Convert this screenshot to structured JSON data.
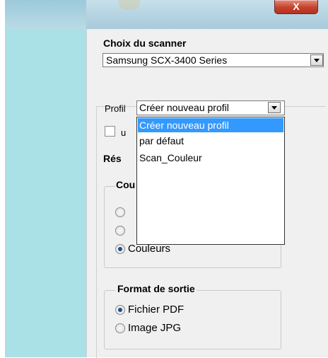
{
  "window": {
    "close_symbol": "X"
  },
  "scanner": {
    "label": "Choix du scanner",
    "selected": "Samsung SCX-3400 Series"
  },
  "profile": {
    "label": "Profil",
    "selected": "Créer nouveau profil",
    "options": [
      "Créer nouveau profil",
      "par défaut",
      "Scan_Couleur"
    ],
    "highlighted_index": 0
  },
  "hidden_labels": {
    "checkbox_partial": "u",
    "resolution_partial": "Rés",
    "color_group_partial": "Cou"
  },
  "color_mode": {
    "options": [
      "",
      "",
      "Couleurs"
    ],
    "selected_index": 2
  },
  "output_format": {
    "title": "Format de sortie",
    "options": [
      "Fichier PDF",
      "Image JPG"
    ],
    "selected_index": 0
  },
  "colors": {
    "left_strip": "#a9e1e6",
    "highlight": "#3399ff",
    "close_button": "#c6422c"
  }
}
